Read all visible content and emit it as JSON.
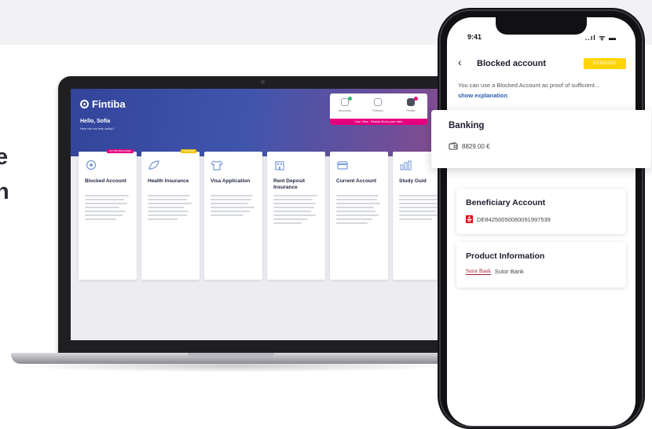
{
  "edge_heading": [
    "e",
    "n"
  ],
  "laptop": {
    "brand": "Fintiba",
    "greeting": "Hello, Sofia",
    "greeting_sub": "How can we help today?",
    "status_items": [
      "Accounts",
      "Policies",
      "Profile"
    ],
    "status_bar": "Your Visa - Ready! Book your date",
    "services": [
      {
        "title": "Blocked Account",
        "badge": "ACTION REQUIRED",
        "badge_color": "#e6007e"
      },
      {
        "title": "Health Insurance",
        "badge": "PENDING",
        "badge_color": "#f5c400"
      },
      {
        "title": "Visa Application",
        "badge": "",
        "badge_color": ""
      },
      {
        "title": "Rent Deposit Insurance",
        "badge": "",
        "badge_color": ""
      },
      {
        "title": "Current Account",
        "badge": "",
        "badge_color": ""
      },
      {
        "title": "Study Guid",
        "badge": "",
        "badge_color": ""
      }
    ]
  },
  "phone": {
    "time": "9:41",
    "status_icons": "..ıl ᯤ ▬",
    "title": "Blocked account",
    "status_badge": "PENDING",
    "hint": "You can use a Blocked Account as proof of sufficient...",
    "hint_link": "show explanation",
    "banking": {
      "title": "Banking",
      "amount": "8829.00 €"
    },
    "beneficiary": {
      "title": "Beneficiary Account",
      "iban": "DE84250050060091997539"
    },
    "product": {
      "title": "Product Information",
      "bank_logo_text": "Sutor Bank",
      "bank_name": "Sutor Bank"
    }
  },
  "colors": {
    "accent_yellow": "#ffd400",
    "accent_magenta": "#e6007e",
    "header_blue": "#3f55ad",
    "link_blue": "#2a5db0",
    "sparkasse_red": "#e30613"
  }
}
